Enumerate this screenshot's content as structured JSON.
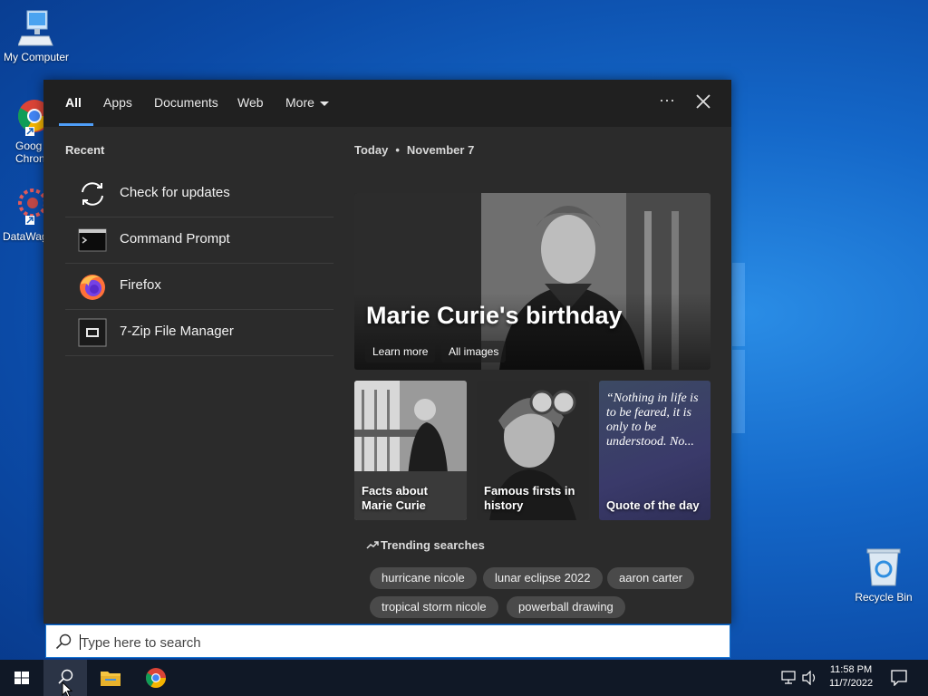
{
  "desktop": {
    "icons": [
      {
        "label": "My Computer"
      },
      {
        "label": "Goog\nChron"
      },
      {
        "label": "DataWag"
      },
      {
        "label": "Recycle Bin"
      }
    ]
  },
  "tabs": [
    {
      "label": "All",
      "active": true
    },
    {
      "label": "Apps"
    },
    {
      "label": "Documents"
    },
    {
      "label": "Web"
    },
    {
      "label": "More"
    }
  ],
  "toolbar": {
    "options_label": "···"
  },
  "recent": {
    "title": "Recent",
    "items": [
      {
        "label": "Check for updates",
        "icon": "refresh-icon"
      },
      {
        "label": "Command Prompt",
        "icon": "cmd-icon"
      },
      {
        "label": "Firefox",
        "icon": "firefox-icon"
      },
      {
        "label": "7-Zip File Manager",
        "icon": "7zip-icon"
      }
    ]
  },
  "today": {
    "label": "Today",
    "date": "November 7",
    "hero": {
      "title": "Marie Curie's birthday",
      "learn_more": "Learn more",
      "all_images": "All images"
    },
    "cards": [
      {
        "label": "Facts about Marie Curie"
      },
      {
        "label": "Famous firsts in history"
      },
      {
        "label": "Quote of the day",
        "quote": "“Nothing in life is to be feared, it is only to be understood. No..."
      }
    ]
  },
  "trending": {
    "title": "Trending searches",
    "chips": [
      "hurricane nicole",
      "lunar eclipse 2022",
      "aaron carter",
      "tropical storm nicole",
      "powerball drawing"
    ]
  },
  "search": {
    "placeholder": "Type here to search"
  },
  "tray": {
    "time": "11:58 PM",
    "date": "11/7/2022"
  },
  "colors": {
    "accent": "#4f9ef8",
    "panel": "#2b2b2b",
    "taskbar": "#101826"
  }
}
